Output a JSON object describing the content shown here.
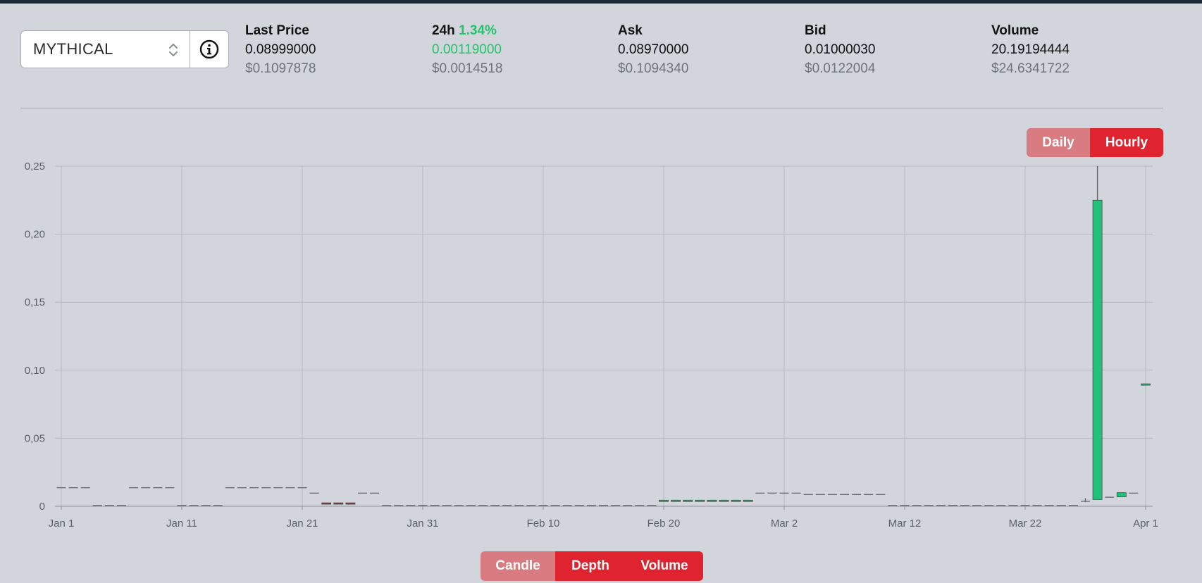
{
  "pair_selector": {
    "value": "MYTHICAL",
    "info_icon": "info-circle-icon",
    "updown_icon": "chevron-updown-icon"
  },
  "stats": [
    {
      "label": "Last Price",
      "value": "0.08999000",
      "usd": "$0.1097878"
    },
    {
      "label": "24h",
      "percent": "1.34%",
      "value": "0.00119000",
      "usd": "$0.0014518",
      "positive": true
    },
    {
      "label": "Ask",
      "value": "0.08970000",
      "usd": "$0.1094340"
    },
    {
      "label": "Bid",
      "value": "0.01000030",
      "usd": "$0.0122004"
    },
    {
      "label": "Volume",
      "value": "20.19194444",
      "usd": "$24.6341722"
    }
  ],
  "interval_buttons": {
    "daily": "Daily",
    "hourly": "Hourly",
    "active": "Hourly"
  },
  "chart_buttons": {
    "candle": "Candle",
    "depth": "Depth",
    "volume": "Volume"
  },
  "colors": {
    "up": "#23c27a",
    "down": "#a0303a",
    "accent": "#e0242f",
    "muted_button": "#d97c82",
    "flat": "#6a6e74"
  },
  "chart_data": {
    "type": "candlestick",
    "title": "",
    "x_tick_labels": [
      "Jan 1",
      "Jan 11",
      "Jan 21",
      "Jan 31",
      "Feb 10",
      "Feb 20",
      "Mar 2",
      "Mar 12",
      "Mar 22",
      "Apr 1"
    ],
    "y_tick_labels": [
      "0",
      "0,05",
      "0,10",
      "0,15",
      "0,20",
      "0,25"
    ],
    "ylim": [
      0,
      0.25
    ],
    "grid": true,
    "candles": [
      {
        "date": "Jan 1",
        "open": 0.014,
        "high": 0.014,
        "low": 0.014,
        "close": 0.014
      },
      {
        "date": "Jan 2",
        "open": 0.014,
        "high": 0.014,
        "low": 0.014,
        "close": 0.014
      },
      {
        "date": "Jan 3",
        "open": 0.014,
        "high": 0.014,
        "low": 0.014,
        "close": 0.014
      },
      {
        "date": "Jan 4",
        "open": 0.001,
        "high": 0.001,
        "low": 0.001,
        "close": 0.001
      },
      {
        "date": "Jan 5",
        "open": 0.001,
        "high": 0.001,
        "low": 0.001,
        "close": 0.001
      },
      {
        "date": "Jan 6",
        "open": 0.001,
        "high": 0.001,
        "low": 0.001,
        "close": 0.001
      },
      {
        "date": "Jan 7",
        "open": 0.014,
        "high": 0.014,
        "low": 0.014,
        "close": 0.014
      },
      {
        "date": "Jan 8",
        "open": 0.014,
        "high": 0.014,
        "low": 0.014,
        "close": 0.014
      },
      {
        "date": "Jan 9",
        "open": 0.014,
        "high": 0.014,
        "low": 0.014,
        "close": 0.014
      },
      {
        "date": "Jan 10",
        "open": 0.014,
        "high": 0.014,
        "low": 0.014,
        "close": 0.014
      },
      {
        "date": "Jan 11",
        "open": 0.001,
        "high": 0.001,
        "low": 0.001,
        "close": 0.001
      },
      {
        "date": "Jan 12",
        "open": 0.001,
        "high": 0.001,
        "low": 0.001,
        "close": 0.001
      },
      {
        "date": "Jan 13",
        "open": 0.001,
        "high": 0.001,
        "low": 0.001,
        "close": 0.001
      },
      {
        "date": "Jan 14",
        "open": 0.001,
        "high": 0.001,
        "low": 0.001,
        "close": 0.001
      },
      {
        "date": "Jan 15",
        "open": 0.014,
        "high": 0.014,
        "low": 0.014,
        "close": 0.014
      },
      {
        "date": "Jan 16",
        "open": 0.014,
        "high": 0.014,
        "low": 0.014,
        "close": 0.014
      },
      {
        "date": "Jan 17",
        "open": 0.014,
        "high": 0.014,
        "low": 0.014,
        "close": 0.014
      },
      {
        "date": "Jan 18",
        "open": 0.014,
        "high": 0.014,
        "low": 0.014,
        "close": 0.014
      },
      {
        "date": "Jan 19",
        "open": 0.014,
        "high": 0.014,
        "low": 0.014,
        "close": 0.014
      },
      {
        "date": "Jan 20",
        "open": 0.014,
        "high": 0.014,
        "low": 0.014,
        "close": 0.014
      },
      {
        "date": "Jan 21",
        "open": 0.014,
        "high": 0.014,
        "low": 0.014,
        "close": 0.014
      },
      {
        "date": "Jan 22",
        "open": 0.01,
        "high": 0.01,
        "low": 0.01,
        "close": 0.01
      },
      {
        "date": "Jan 23",
        "open": 0.0025,
        "high": 0.0025,
        "low": 0.0015,
        "close": 0.0015
      },
      {
        "date": "Jan 24",
        "open": 0.0025,
        "high": 0.0025,
        "low": 0.0015,
        "close": 0.0015
      },
      {
        "date": "Jan 25",
        "open": 0.0025,
        "high": 0.0025,
        "low": 0.0015,
        "close": 0.0015
      },
      {
        "date": "Jan 26",
        "open": 0.01,
        "high": 0.01,
        "low": 0.01,
        "close": 0.01
      },
      {
        "date": "Jan 27",
        "open": 0.01,
        "high": 0.01,
        "low": 0.01,
        "close": 0.01
      },
      {
        "date": "Jan 28",
        "open": 0.001,
        "high": 0.001,
        "low": 0.001,
        "close": 0.001
      },
      {
        "date": "Jan 29",
        "open": 0.001,
        "high": 0.001,
        "low": 0.001,
        "close": 0.001
      },
      {
        "date": "Jan 30",
        "open": 0.001,
        "high": 0.001,
        "low": 0.001,
        "close": 0.001
      },
      {
        "date": "Jan 31",
        "open": 0.001,
        "high": 0.001,
        "low": 0.001,
        "close": 0.001
      },
      {
        "date": "Feb 1",
        "open": 0.001,
        "high": 0.001,
        "low": 0.001,
        "close": 0.001
      },
      {
        "date": "Feb 2",
        "open": 0.001,
        "high": 0.001,
        "low": 0.001,
        "close": 0.001
      },
      {
        "date": "Feb 3",
        "open": 0.001,
        "high": 0.001,
        "low": 0.001,
        "close": 0.001
      },
      {
        "date": "Feb 4",
        "open": 0.001,
        "high": 0.001,
        "low": 0.001,
        "close": 0.001
      },
      {
        "date": "Feb 5",
        "open": 0.001,
        "high": 0.001,
        "low": 0.001,
        "close": 0.001
      },
      {
        "date": "Feb 6",
        "open": 0.001,
        "high": 0.001,
        "low": 0.001,
        "close": 0.001
      },
      {
        "date": "Feb 7",
        "open": 0.001,
        "high": 0.001,
        "low": 0.001,
        "close": 0.001
      },
      {
        "date": "Feb 8",
        "open": 0.001,
        "high": 0.001,
        "low": 0.001,
        "close": 0.001
      },
      {
        "date": "Feb 9",
        "open": 0.001,
        "high": 0.001,
        "low": 0.001,
        "close": 0.001
      },
      {
        "date": "Feb 10",
        "open": 0.001,
        "high": 0.001,
        "low": 0.001,
        "close": 0.001
      },
      {
        "date": "Feb 11",
        "open": 0.001,
        "high": 0.001,
        "low": 0.001,
        "close": 0.001
      },
      {
        "date": "Feb 12",
        "open": 0.001,
        "high": 0.001,
        "low": 0.001,
        "close": 0.001
      },
      {
        "date": "Feb 13",
        "open": 0.001,
        "high": 0.001,
        "low": 0.001,
        "close": 0.001
      },
      {
        "date": "Feb 14",
        "open": 0.001,
        "high": 0.001,
        "low": 0.001,
        "close": 0.001
      },
      {
        "date": "Feb 15",
        "open": 0.001,
        "high": 0.001,
        "low": 0.001,
        "close": 0.001
      },
      {
        "date": "Feb 16",
        "open": 0.001,
        "high": 0.001,
        "low": 0.001,
        "close": 0.001
      },
      {
        "date": "Feb 17",
        "open": 0.001,
        "high": 0.001,
        "low": 0.001,
        "close": 0.001
      },
      {
        "date": "Feb 18",
        "open": 0.001,
        "high": 0.001,
        "low": 0.001,
        "close": 0.001
      },
      {
        "date": "Feb 19",
        "open": 0.001,
        "high": 0.001,
        "low": 0.001,
        "close": 0.001
      },
      {
        "date": "Feb 20",
        "open": 0.0035,
        "high": 0.0045,
        "low": 0.0035,
        "close": 0.0045
      },
      {
        "date": "Feb 21",
        "open": 0.0035,
        "high": 0.0045,
        "low": 0.0035,
        "close": 0.0045
      },
      {
        "date": "Feb 22",
        "open": 0.0035,
        "high": 0.0045,
        "low": 0.0035,
        "close": 0.0045
      },
      {
        "date": "Feb 23",
        "open": 0.0035,
        "high": 0.0045,
        "low": 0.0035,
        "close": 0.0045
      },
      {
        "date": "Feb 24",
        "open": 0.0035,
        "high": 0.0045,
        "low": 0.0035,
        "close": 0.0045
      },
      {
        "date": "Feb 25",
        "open": 0.0035,
        "high": 0.0045,
        "low": 0.0035,
        "close": 0.0045
      },
      {
        "date": "Feb 26",
        "open": 0.0035,
        "high": 0.0045,
        "low": 0.0035,
        "close": 0.0045
      },
      {
        "date": "Feb 27",
        "open": 0.0035,
        "high": 0.0045,
        "low": 0.0035,
        "close": 0.0045
      },
      {
        "date": "Feb 28",
        "open": 0.01,
        "high": 0.01,
        "low": 0.01,
        "close": 0.01
      },
      {
        "date": "Mar 1",
        "open": 0.01,
        "high": 0.01,
        "low": 0.01,
        "close": 0.01
      },
      {
        "date": "Mar 2",
        "open": 0.01,
        "high": 0.01,
        "low": 0.01,
        "close": 0.01
      },
      {
        "date": "Mar 3",
        "open": 0.01,
        "high": 0.01,
        "low": 0.01,
        "close": 0.01
      },
      {
        "date": "Mar 4",
        "open": 0.009,
        "high": 0.009,
        "low": 0.009,
        "close": 0.009
      },
      {
        "date": "Mar 5",
        "open": 0.009,
        "high": 0.009,
        "low": 0.009,
        "close": 0.009
      },
      {
        "date": "Mar 6",
        "open": 0.009,
        "high": 0.009,
        "low": 0.009,
        "close": 0.009
      },
      {
        "date": "Mar 7",
        "open": 0.009,
        "high": 0.009,
        "low": 0.009,
        "close": 0.009
      },
      {
        "date": "Mar 8",
        "open": 0.009,
        "high": 0.009,
        "low": 0.009,
        "close": 0.009
      },
      {
        "date": "Mar 9",
        "open": 0.009,
        "high": 0.009,
        "low": 0.009,
        "close": 0.009
      },
      {
        "date": "Mar 10",
        "open": 0.009,
        "high": 0.009,
        "low": 0.009,
        "close": 0.009
      },
      {
        "date": "Mar 11",
        "open": 0.001,
        "high": 0.001,
        "low": 0.001,
        "close": 0.001
      },
      {
        "date": "Mar 12",
        "open": 0.001,
        "high": 0.001,
        "low": 0.001,
        "close": 0.001
      },
      {
        "date": "Mar 13",
        "open": 0.001,
        "high": 0.001,
        "low": 0.001,
        "close": 0.001
      },
      {
        "date": "Mar 14",
        "open": 0.001,
        "high": 0.001,
        "low": 0.001,
        "close": 0.001
      },
      {
        "date": "Mar 15",
        "open": 0.001,
        "high": 0.001,
        "low": 0.001,
        "close": 0.001
      },
      {
        "date": "Mar 16",
        "open": 0.001,
        "high": 0.001,
        "low": 0.001,
        "close": 0.001
      },
      {
        "date": "Mar 17",
        "open": 0.001,
        "high": 0.001,
        "low": 0.001,
        "close": 0.001
      },
      {
        "date": "Mar 18",
        "open": 0.001,
        "high": 0.001,
        "low": 0.001,
        "close": 0.001
      },
      {
        "date": "Mar 19",
        "open": 0.001,
        "high": 0.001,
        "low": 0.001,
        "close": 0.001
      },
      {
        "date": "Mar 20",
        "open": 0.001,
        "high": 0.001,
        "low": 0.001,
        "close": 0.001
      },
      {
        "date": "Mar 21",
        "open": 0.001,
        "high": 0.001,
        "low": 0.001,
        "close": 0.001
      },
      {
        "date": "Mar 22",
        "open": 0.001,
        "high": 0.001,
        "low": 0.001,
        "close": 0.001
      },
      {
        "date": "Mar 23",
        "open": 0.001,
        "high": 0.001,
        "low": 0.001,
        "close": 0.001
      },
      {
        "date": "Mar 24",
        "open": 0.001,
        "high": 0.001,
        "low": 0.001,
        "close": 0.001
      },
      {
        "date": "Mar 25",
        "open": 0.001,
        "high": 0.001,
        "low": 0.001,
        "close": 0.001
      },
      {
        "date": "Mar 26",
        "open": 0.001,
        "high": 0.001,
        "low": 0.001,
        "close": 0.001
      },
      {
        "date": "Mar 27",
        "open": 0.004,
        "high": 0.006,
        "low": 0.003,
        "close": 0.004
      },
      {
        "date": "Mar 28",
        "open": 0.005,
        "high": 0.25,
        "low": 0.005,
        "close": 0.225
      },
      {
        "date": "Mar 29",
        "open": 0.007,
        "high": 0.007,
        "low": 0.007,
        "close": 0.007
      },
      {
        "date": "Mar 30",
        "open": 0.007,
        "high": 0.01,
        "low": 0.007,
        "close": 0.01
      },
      {
        "date": "Mar 31",
        "open": 0.01,
        "high": 0.01,
        "low": 0.01,
        "close": 0.01
      },
      {
        "date": "Apr 1",
        "open": 0.089,
        "high": 0.09,
        "low": 0.089,
        "close": 0.09
      }
    ]
  }
}
